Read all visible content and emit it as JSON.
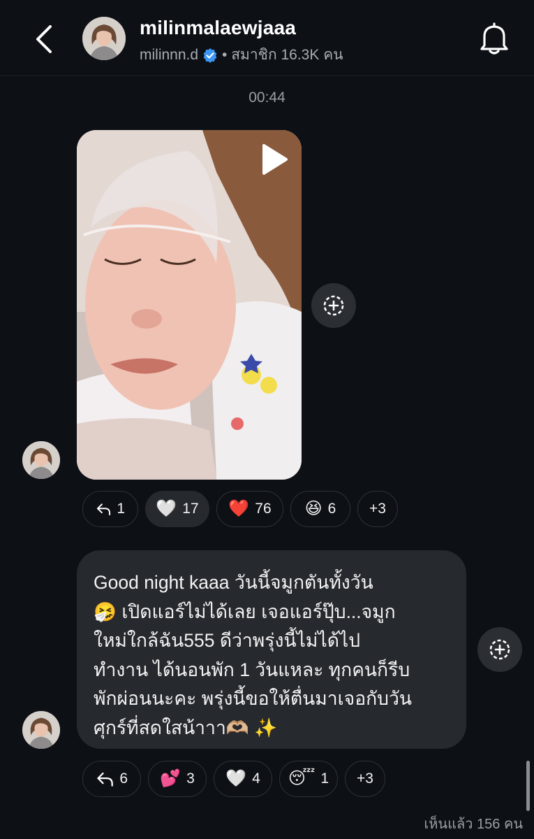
{
  "header": {
    "channel_name": "milinmalaewjaaa",
    "username": "milinnn.d",
    "member_info": "• สมาชิก 16.3K คน"
  },
  "icons": {
    "back": "chevron-left-icon",
    "notifications": "bell-icon",
    "verified": "verified-badge-icon",
    "share": "add-share-icon",
    "reply": "reply-arrow-icon",
    "play": "play-icon"
  },
  "colors": {
    "background": "#0d1015",
    "bubble": "#26292e",
    "chip_border": "#2f3238",
    "verified_blue": "#3b97f3",
    "muted_text": "#9b9fa5"
  },
  "messages": [
    {
      "timestamp": "00:44",
      "type": "video",
      "reactions": [
        {
          "icon": "reply",
          "label": "1"
        },
        {
          "emoji": "🤍",
          "label": "17",
          "active": true
        },
        {
          "emoji": "❤️",
          "label": "76"
        },
        {
          "emoji": "😆",
          "label": "6"
        },
        {
          "label": "+3"
        }
      ]
    },
    {
      "type": "text",
      "text": "Good night kaaa วันนี้จมูกตันทั้งวัน\n🤧 เปิดแอร์ไม่ได้เลย เจอแอร์ปุ๊บ...จมูก\nใหม่ใกล้ฉัน555 ดีว่าพรุ่งนี้ไม่ได้ไป\nทำงาน ได้นอนพัก 1 วันแหละ ทุกคนก็รีบ\nพักผ่อนนะคะ พรุ่งนี้ขอให้ตื่นมาเจอกับวัน\nศุกร์ที่สดใสน้าาา🫶🏼 ✨",
      "reactions": [
        {
          "icon": "reply",
          "label": "6"
        },
        {
          "emoji": "💕",
          "label": "3"
        },
        {
          "emoji": "🤍",
          "label": "4"
        },
        {
          "emoji": "😴",
          "label": "1"
        },
        {
          "label": "+3"
        }
      ]
    }
  ],
  "footer": {
    "seen": "เห็นแล้ว 156 คน"
  }
}
